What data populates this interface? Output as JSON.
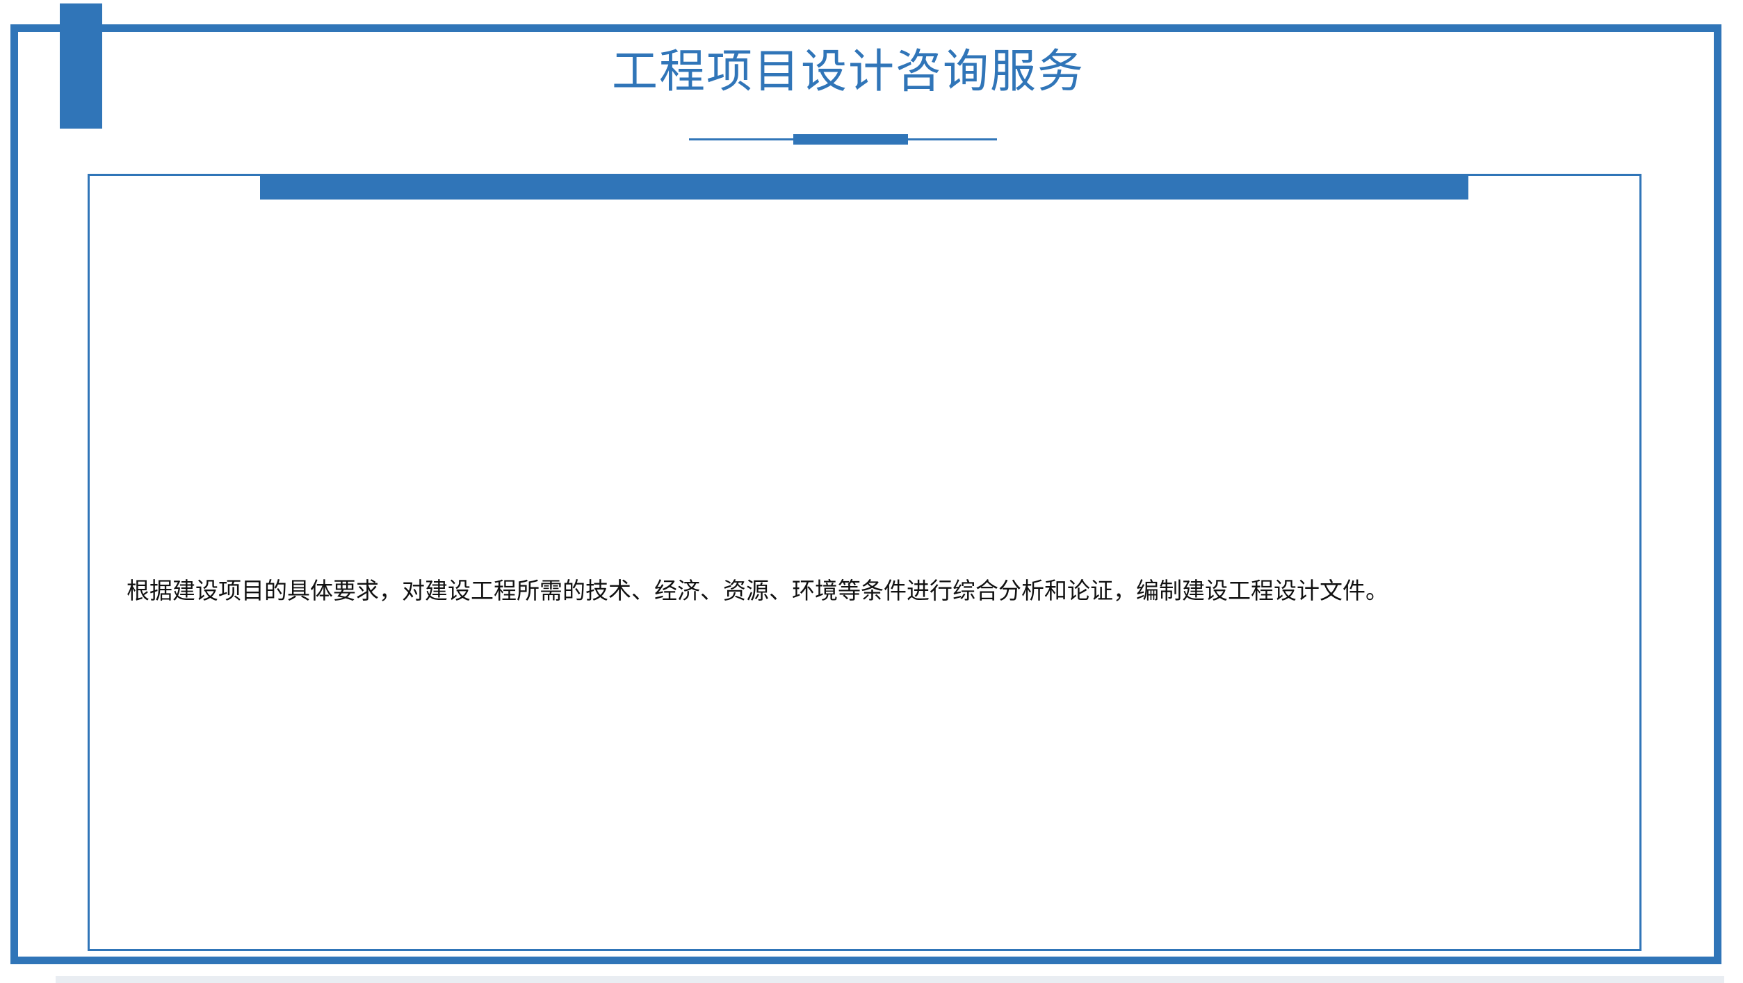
{
  "slide": {
    "title": "工程项目设计咨询服务",
    "body": "根据建设项目的具体要求，对建设工程所需的技术、经济、资源、环境等条件进行综合分析和论证，编制建设工程设计文件。"
  },
  "colors": {
    "accent": "#3075b8",
    "text": "#111111",
    "background": "#ffffff"
  }
}
